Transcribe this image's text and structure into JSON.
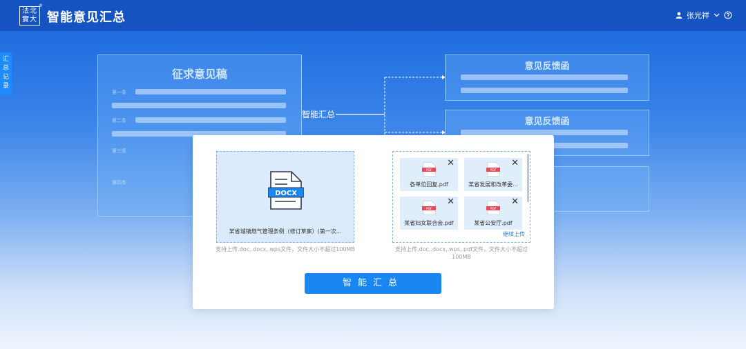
{
  "header": {
    "logo_top": "法北",
    "logo_bottom": "實大",
    "logo_mark": "®",
    "title": "智能意见汇总",
    "user_name": "张光祥"
  },
  "side_tab": {
    "label": "汇总记录"
  },
  "background": {
    "source_card_title": "征求意见稿",
    "flow_label": "智能汇总",
    "feedback_card_title_1": "意见反馈函",
    "feedback_card_title_2": "意见反馈函",
    "item_labels": [
      "第一条",
      "第二条",
      "第三条",
      "第四条"
    ]
  },
  "modal": {
    "left_upload": {
      "doc_badge": "DOCX",
      "file_name": "某省城镇燃气管理条例（修订草案）(第一次...",
      "hint": "支持上传.doc,.docx,.wps文件，文件大小不超过100MB"
    },
    "right_upload": {
      "files": [
        {
          "name": "各单位回复.pdf"
        },
        {
          "name": "某省发展和改革委..."
        },
        {
          "name": "某省妇女联合会.pdf"
        },
        {
          "name": "某省公安厅.pdf"
        }
      ],
      "pdf_badge": "PDF",
      "continue_label": "继续上传",
      "hint_line1": "支持上传.doc,.docx,.wps,.pdf文件，文件大小不超过",
      "hint_line2": "100MB"
    },
    "submit_label": "智能汇总"
  },
  "colors": {
    "header": "#1553c2",
    "accent": "#1a86f2",
    "pdf_red": "#e74a5b"
  }
}
